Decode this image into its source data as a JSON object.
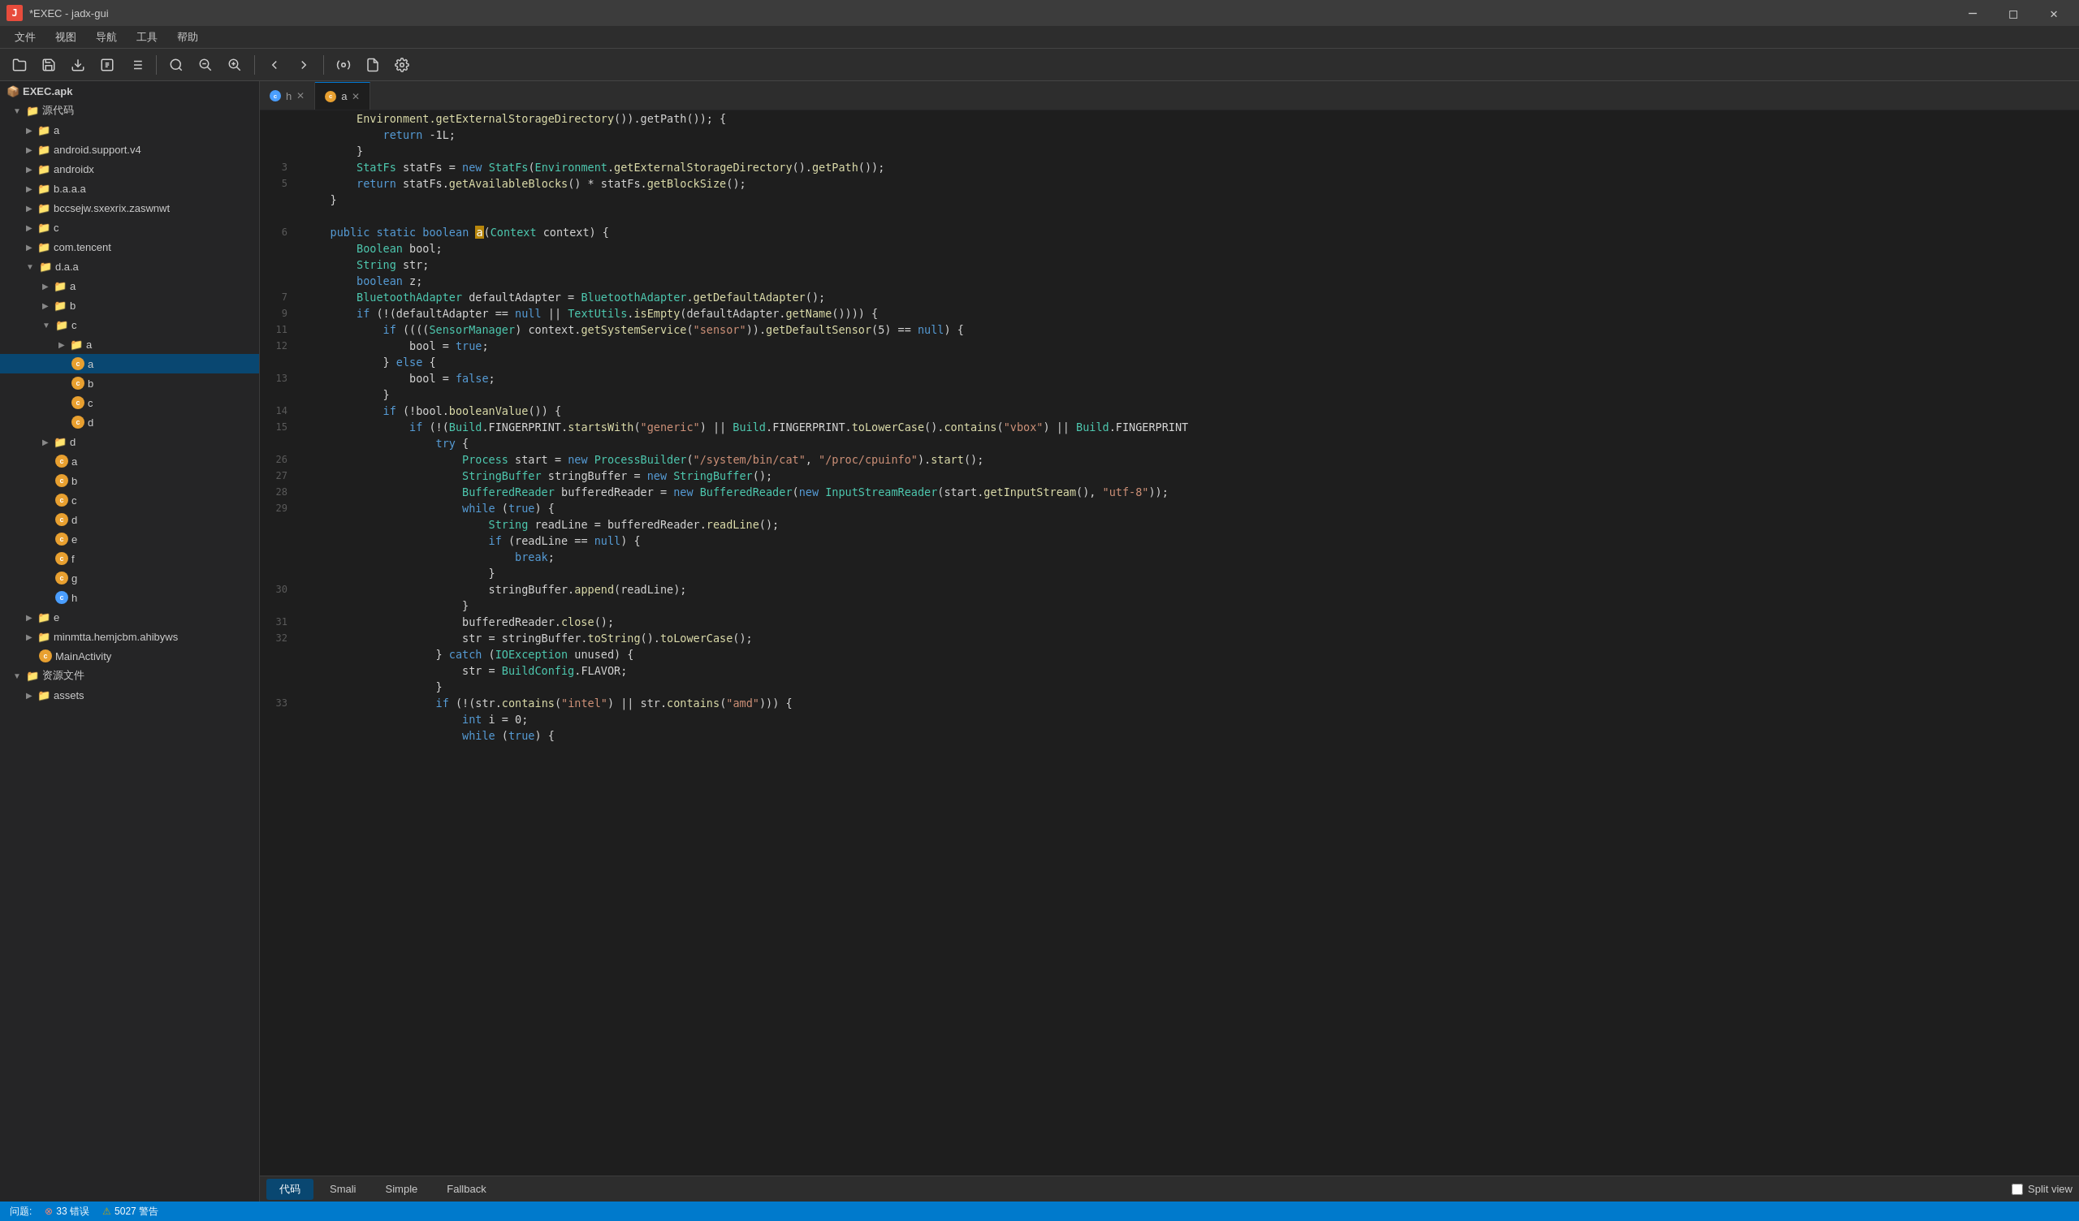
{
  "titleBar": {
    "title": "*EXEC - jadx-gui",
    "icon": "J"
  },
  "menuBar": {
    "items": [
      "文件",
      "视图",
      "导航",
      "工具",
      "帮助"
    ]
  },
  "toolbar": {
    "buttons": [
      {
        "name": "open",
        "icon": "📂"
      },
      {
        "name": "save-all",
        "icon": "💾"
      },
      {
        "name": "save",
        "icon": "🗂"
      },
      {
        "name": "export",
        "icon": "📤"
      },
      {
        "name": "export2",
        "icon": "📋"
      },
      {
        "name": "find",
        "icon": "🔍"
      },
      {
        "name": "find-usage",
        "icon": "🔎"
      },
      {
        "name": "find-all",
        "icon": "🔭"
      },
      {
        "name": "nav-back",
        "icon": "←"
      },
      {
        "name": "nav-forward",
        "icon": "→"
      },
      {
        "name": "refresh",
        "icon": "↻"
      },
      {
        "name": "decompile",
        "icon": "⚙"
      },
      {
        "name": "log",
        "icon": "📄"
      },
      {
        "name": "settings",
        "icon": "🔧"
      }
    ]
  },
  "sidebar": {
    "rootFile": "EXEC.apk",
    "items": [
      {
        "label": "源代码",
        "type": "folder",
        "level": 0,
        "expanded": true
      },
      {
        "label": "a",
        "type": "folder",
        "level": 1,
        "expanded": false
      },
      {
        "label": "android.support.v4",
        "type": "folder",
        "level": 1,
        "expanded": false
      },
      {
        "label": "androidx",
        "type": "folder",
        "level": 1,
        "expanded": false
      },
      {
        "label": "b.a.a.a",
        "type": "folder",
        "level": 1,
        "expanded": false
      },
      {
        "label": "bccsejw.sxexrix.zaswnwt",
        "type": "folder",
        "level": 1,
        "expanded": false
      },
      {
        "label": "c",
        "type": "folder",
        "level": 1,
        "expanded": false
      },
      {
        "label": "com.tencent",
        "type": "folder",
        "level": 1,
        "expanded": false
      },
      {
        "label": "d.a.a",
        "type": "folder",
        "level": 1,
        "expanded": true
      },
      {
        "label": "a",
        "type": "folder",
        "level": 2,
        "expanded": false
      },
      {
        "label": "b",
        "type": "folder",
        "level": 2,
        "expanded": false
      },
      {
        "label": "c",
        "type": "folder",
        "level": 2,
        "expanded": true
      },
      {
        "label": "a",
        "type": "folder",
        "level": 3,
        "expanded": false
      },
      {
        "label": "a",
        "type": "class",
        "level": 3,
        "iconType": "orange",
        "selected": true
      },
      {
        "label": "b",
        "type": "class",
        "level": 3,
        "iconType": "orange"
      },
      {
        "label": "c",
        "type": "class",
        "level": 3,
        "iconType": "orange"
      },
      {
        "label": "d",
        "type": "class",
        "level": 3,
        "iconType": "orange"
      },
      {
        "label": "d",
        "type": "folder",
        "level": 2,
        "expanded": false
      },
      {
        "label": "a",
        "type": "class",
        "level": 2,
        "iconType": "orange"
      },
      {
        "label": "b",
        "type": "class",
        "level": 2,
        "iconType": "orange"
      },
      {
        "label": "c",
        "type": "class",
        "level": 2,
        "iconType": "orange"
      },
      {
        "label": "d",
        "type": "class",
        "level": 2,
        "iconType": "orange"
      },
      {
        "label": "e",
        "type": "class",
        "level": 2,
        "iconType": "orange"
      },
      {
        "label": "f",
        "type": "class",
        "level": 2,
        "iconType": "orange"
      },
      {
        "label": "g",
        "type": "class",
        "level": 2,
        "iconType": "orange"
      },
      {
        "label": "h",
        "type": "class",
        "level": 2,
        "iconType": "blue"
      },
      {
        "label": "e",
        "type": "folder",
        "level": 1,
        "expanded": false
      },
      {
        "label": "minmtta.hemjcbm.ahibyws",
        "type": "folder",
        "level": 1,
        "expanded": false
      },
      {
        "label": "MainActivity",
        "type": "class",
        "level": 1,
        "iconType": "orange"
      },
      {
        "label": "资源文件",
        "type": "folder",
        "level": 0,
        "expanded": true
      },
      {
        "label": "assets",
        "type": "folder",
        "level": 1,
        "expanded": false
      }
    ]
  },
  "tabs": [
    {
      "label": "h",
      "active": false,
      "iconType": "blue"
    },
    {
      "label": "a",
      "active": true,
      "iconType": "orange"
    }
  ],
  "codeLines": [
    {
      "num": "",
      "content": ""
    },
    {
      "num": "3",
      "content": "        StatFs statFs = new StatFs(Environment.getExternalStorageDirectory().getPath());"
    },
    {
      "num": "5",
      "content": "        return statFs.getAvailableBlocks() * statFs.getBlockSize();"
    },
    {
      "num": "",
      "content": "    }"
    },
    {
      "num": "",
      "content": ""
    },
    {
      "num": "6",
      "content": "    public static boolean a(Context context) {"
    },
    {
      "num": "",
      "content": "        Boolean bool;"
    },
    {
      "num": "",
      "content": "        String str;"
    },
    {
      "num": "",
      "content": "        boolean z;"
    },
    {
      "num": "7",
      "content": "        BluetoothAdapter defaultAdapter = BluetoothAdapter.getDefaultAdapter();"
    },
    {
      "num": "9",
      "content": "        if (!(defaultAdapter == null || TextUtils.isEmpty(defaultAdapter.getName()))) {"
    },
    {
      "num": "11",
      "content": "            if (((SensorManager) context.getSystemService(\"sensor\")).getDefaultSensor(5) == null) {"
    },
    {
      "num": "12",
      "content": "                bool = true;"
    },
    {
      "num": "",
      "content": "            } else {"
    },
    {
      "num": "13",
      "content": "                bool = false;"
    },
    {
      "num": "",
      "content": "            }"
    },
    {
      "num": "14",
      "content": "            if (!bool.booleanValue()) {"
    },
    {
      "num": "15",
      "content": "                if (!(Build.FINGERPRINT.startsWith(\"generic\") || Build.FINGERPRINT.toLowerCase().contains(\"vbox\") || Build.FINGERPRINT"
    },
    {
      "num": "",
      "content": "                    try {"
    },
    {
      "num": "26",
      "content": "                        Process start = new ProcessBuilder(\"/system/bin/cat\", \"/proc/cpuinfo\").start();"
    },
    {
      "num": "27",
      "content": "                        StringBuffer stringBuffer = new StringBuffer();"
    },
    {
      "num": "28",
      "content": "                        BufferedReader bufferedReader = new BufferedReader(new InputStreamReader(start.getInputStream(), \"utf-8\"));"
    },
    {
      "num": "29",
      "content": "                        while (true) {"
    },
    {
      "num": "",
      "content": "                            String readLine = bufferedReader.readLine();"
    },
    {
      "num": "",
      "content": "                            if (readLine == null) {"
    },
    {
      "num": "",
      "content": "                                break;"
    },
    {
      "num": "",
      "content": "                            }"
    },
    {
      "num": "30",
      "content": "                            stringBuffer.append(readLine);"
    },
    {
      "num": "",
      "content": "                        }"
    },
    {
      "num": "31",
      "content": "                        bufferedReader.close();"
    },
    {
      "num": "32",
      "content": "                        str = stringBuffer.toString().toLowerCase();"
    },
    {
      "num": "",
      "content": "                    } catch (IOException unused) {"
    },
    {
      "num": "",
      "content": "                        str = BuildConfig.FLAVOR;"
    },
    {
      "num": "",
      "content": "                    }"
    },
    {
      "num": "33",
      "content": "                    if (!(str.contains(\"intel\") || str.contains(\"amd\"))) {"
    },
    {
      "num": "",
      "content": "                        int i = 0;"
    },
    {
      "num": "",
      "content": "                        while (true) {"
    }
  ],
  "statusBar": {
    "question": "问题:",
    "errors": "33 错误",
    "warnings": "5027 警告"
  },
  "bottomTabs": {
    "tabs": [
      "代码",
      "Smali",
      "Simple",
      "Fallback"
    ],
    "activeTab": "代码",
    "splitViewLabel": "Split view"
  }
}
